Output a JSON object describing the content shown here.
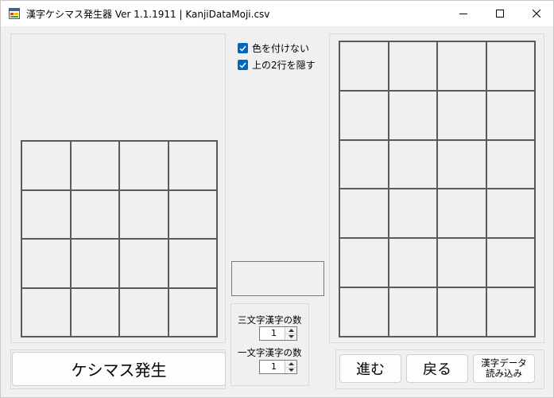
{
  "window": {
    "title": "漢字ケシマス発生器 Ver 1.1.1911 | KanjiDataMoji.csv",
    "app_icon": "app-window-icon",
    "caption_buttons": [
      "minimize-icon",
      "maximize-icon",
      "close-icon"
    ]
  },
  "options": {
    "no_color_label": "色を付けない",
    "no_color_checked": true,
    "hide_top_rows_label": "上の2行を隠す",
    "hide_top_rows_checked": true
  },
  "counters": {
    "three_char_label": "三文字漢字の数",
    "three_char_value": "1",
    "one_char_label": "一文字漢字の数",
    "one_char_value": "1"
  },
  "buttons": {
    "generate": "ケシマス発生",
    "next": "進む",
    "back": "戻る",
    "load_line1": "漢字データ",
    "load_line2": "読み込み"
  },
  "colors": {
    "accent": "#0067c0",
    "grid_line": "#5a5a5a",
    "background": "#f0f0f0"
  }
}
